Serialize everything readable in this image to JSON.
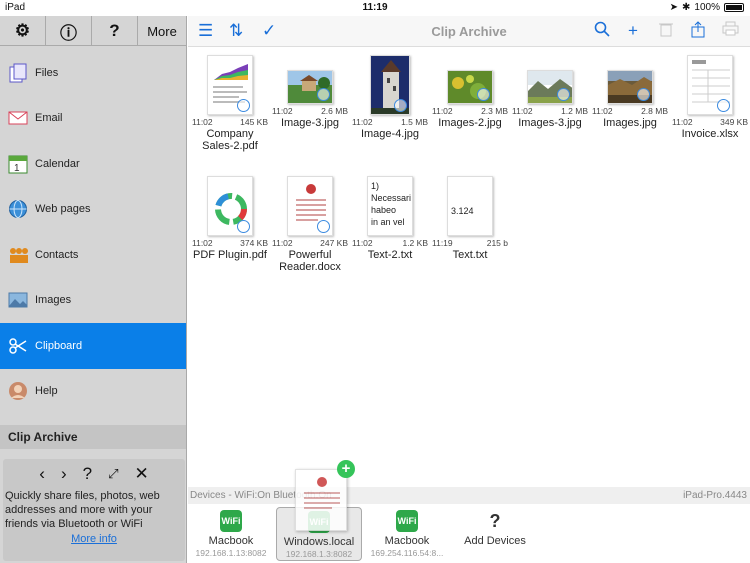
{
  "status": {
    "device": "iPad",
    "time": "11:19",
    "battery": "100%"
  },
  "sidebar": {
    "top_buttons": [
      {
        "icon": "gear-icon",
        "glyph": "⚙"
      },
      {
        "icon": "info-icon",
        "glyph": "ⓘ"
      },
      {
        "icon": "question-icon",
        "glyph": "?"
      }
    ],
    "more_label": "More",
    "items": [
      {
        "label": "Files",
        "icon": "files-icon"
      },
      {
        "label": "Email",
        "icon": "email-icon"
      },
      {
        "label": "Calendar",
        "icon": "calendar-icon"
      },
      {
        "label": "Web pages",
        "icon": "globe-icon"
      },
      {
        "label": "Contacts",
        "icon": "contacts-icon"
      },
      {
        "label": "Images",
        "icon": "images-icon"
      },
      {
        "label": "Clipboard",
        "icon": "clipboard-icon"
      },
      {
        "label": "Help",
        "icon": "help-icon"
      }
    ],
    "section_title": "Clip Archive",
    "info_text": "Quickly share files, photos, web addresses and more with your friends via Bluetooth or WiFi",
    "info_link": "More info"
  },
  "toolbar": {
    "title": "Clip Archive"
  },
  "files": [
    {
      "time": "11:02",
      "size": "145 KB",
      "name": "Company Sales-2.pdf"
    },
    {
      "time": "11:02",
      "size": "2.6 MB",
      "name": "Image-3.jpg"
    },
    {
      "time": "11:02",
      "size": "1.5 MB",
      "name": "Image-4.jpg"
    },
    {
      "time": "11:02",
      "size": "2.3 MB",
      "name": "Images-2.jpg"
    },
    {
      "time": "11:02",
      "size": "1.2 MB",
      "name": "Images-3.jpg"
    },
    {
      "time": "11:02",
      "size": "2.8 MB",
      "name": "Images.jpg"
    },
    {
      "time": "11:02",
      "size": "349 KB",
      "name": "Invoice.xlsx"
    },
    {
      "time": "11:02",
      "size": "374 KB",
      "name": "PDF Plugin.pdf"
    },
    {
      "time": "11:02",
      "size": "247 KB",
      "name": "Powerful Reader.docx"
    },
    {
      "time": "11:02",
      "size": "1.2 KB",
      "name": "Text-2.txt",
      "preview": "1)\nNecessari\nhabeo\nin an vel"
    },
    {
      "time": "11:19",
      "size": "215 b",
      "name": "Text.txt",
      "preview": "3.124"
    }
  ],
  "devices_bar": {
    "status": "Devices - WiFi:On  Bluetooth:On",
    "host": "iPad-Pro.4443"
  },
  "devices": [
    {
      "name": "Macbook",
      "address": "192.168.1.13:8082"
    },
    {
      "name": "Windows.local",
      "address": "192.168.1.3:8082"
    },
    {
      "name": "Macbook",
      "address": "169.254.116.54:8..."
    },
    {
      "name": "Add Devices",
      "address": ""
    }
  ]
}
